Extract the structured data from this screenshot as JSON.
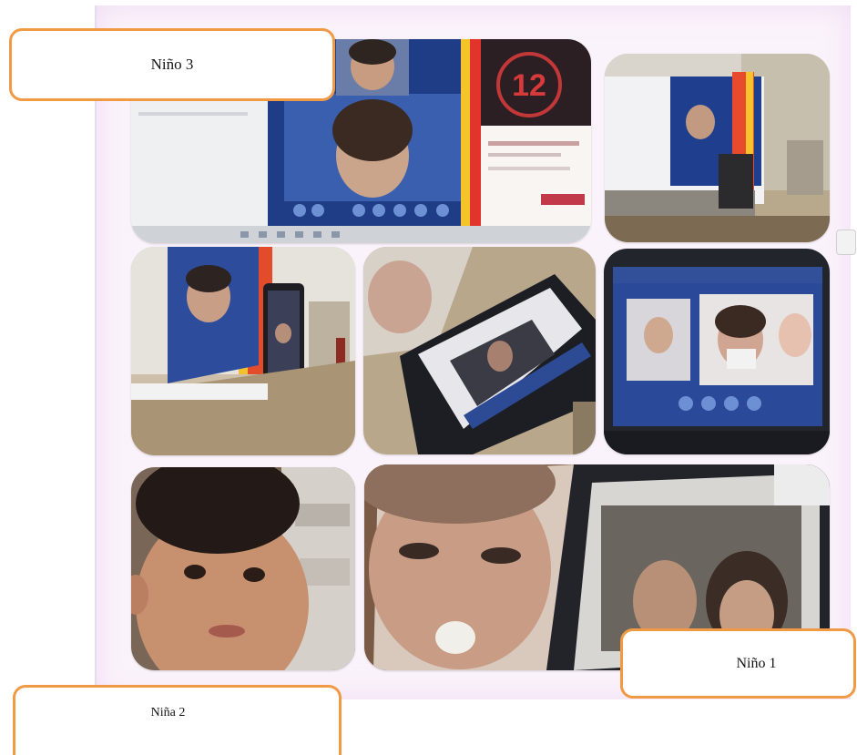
{
  "labels": {
    "nino3": "Niño 3",
    "nino1": "Niño 1",
    "nina2": "Niña 2"
  },
  "photo1_badge": "12",
  "colors": {
    "label_border": "#f09a45",
    "collage_background": "#fbf3fb",
    "video_call_blue": "#2a4c9a"
  },
  "photos": [
    {
      "id": "photo-video-call-laptop-screen"
    },
    {
      "id": "photo-laptop-in-room"
    },
    {
      "id": "photo-laptop-and-phone-on-desk"
    },
    {
      "id": "photo-tablet-video-call-angled"
    },
    {
      "id": "photo-tablet-video-call-participants"
    },
    {
      "id": "photo-girl-closeup"
    },
    {
      "id": "photo-child-with-tablet-closeup"
    }
  ]
}
